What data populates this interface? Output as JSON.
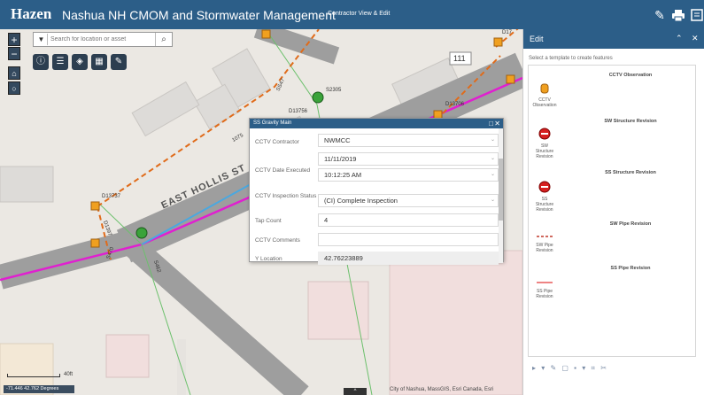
{
  "header": {
    "logo": "Hazen",
    "title": "Nashua NH CMOM and Stormwater Management",
    "view_mode": "Contractor View & Edit",
    "icons": [
      "pencil-icon",
      "print-icon",
      "layers-icon"
    ]
  },
  "map": {
    "zoom_in": "+",
    "zoom_out": "−",
    "search": {
      "placeholder": "Search for location or asset"
    },
    "toolbar_icons": [
      "info-icon",
      "list-icon",
      "layers-icon",
      "basemap-icon",
      "edit-icon"
    ],
    "labels": {
      "street": "EAST HOLLIS ST",
      "route_shield": "111",
      "asset_s2305": "S2305",
      "asset_d13756": "D13756",
      "asset_d13706": "D13706",
      "asset_d13737": "D13737",
      "asset_d1397": "D1397",
      "asset_d17": "D17",
      "seg_ss": "SS47",
      "seg_b": "S462",
      "seg_c": "S470",
      "seg_d": "1075"
    },
    "scale_label": "40ft",
    "coordinates": "-71.446 42.762 Degrees",
    "attribution": "City of Nashua, MassGIS, Esri Canada, Esri",
    "bottom_toggle": "^"
  },
  "popup": {
    "title": "SS Gravity Main",
    "fields": [
      {
        "label": "CCTV Contractor",
        "value": "NWMCC"
      },
      {
        "label": "CCTV Date Executed",
        "value": "11/11/2019",
        "time": "10:12:25 AM"
      },
      {
        "label": "CCTV Inspection Status",
        "value": "(CI) Complete Inspection"
      },
      {
        "label": "Tap Count",
        "value": "4"
      },
      {
        "label": "CCTV Comments",
        "value": ""
      },
      {
        "label": "Y Location",
        "value": "42.76223889"
      }
    ]
  },
  "edit_panel": {
    "title": "Edit",
    "description": "Select a template to create features",
    "sections": [
      {
        "title": "CCTV Observation",
        "item": "CCTV Observation",
        "symbol": "cctv-observation-symbol"
      },
      {
        "title": "SW Structure Revision",
        "item": "SW Structure Revision",
        "symbol": "sw-structure-symbol"
      },
      {
        "title": "SS Structure Revision",
        "item": "SS Structure Revision",
        "symbol": "ss-structure-symbol"
      },
      {
        "title": "SW Pipe Revision",
        "item": "SW Pipe Revision",
        "symbol": "sw-pipe-symbol"
      },
      {
        "title": "SS Pipe Revision",
        "item": "SS Pipe Revision",
        "symbol": "ss-pipe-symbol"
      }
    ],
    "toolbar": "▸ ▾ ✎ ▢ ▪ ▾ ⌗ ✂",
    "colors": {
      "accent": "#2c5e88",
      "sw_pipe": "#c0392b",
      "ss_pipe": "#e85a5a",
      "structure": "#d62020",
      "cctv": "#f0a020"
    }
  }
}
